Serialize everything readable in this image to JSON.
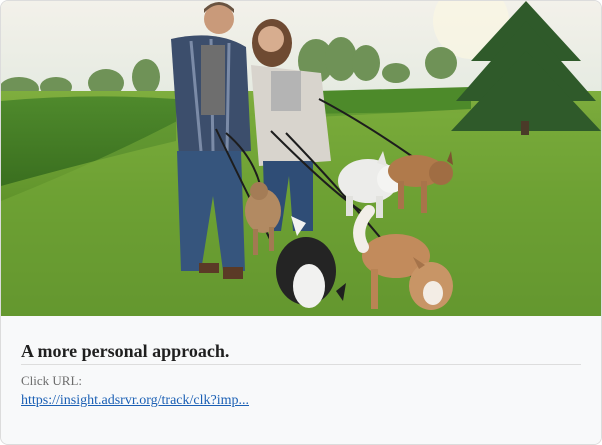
{
  "card": {
    "image_alt": "Couple walking five dogs on leashes through a grassy field",
    "title": "A more personal approach.",
    "url_label": "Click URL:",
    "url_text": "https://insight.adsrvr.org/track/clk?imp..."
  },
  "colors": {
    "title": "#1f1f1f",
    "label": "#6b6b6b",
    "link": "#1a5fb4",
    "card_background": "#f8f9fa"
  }
}
